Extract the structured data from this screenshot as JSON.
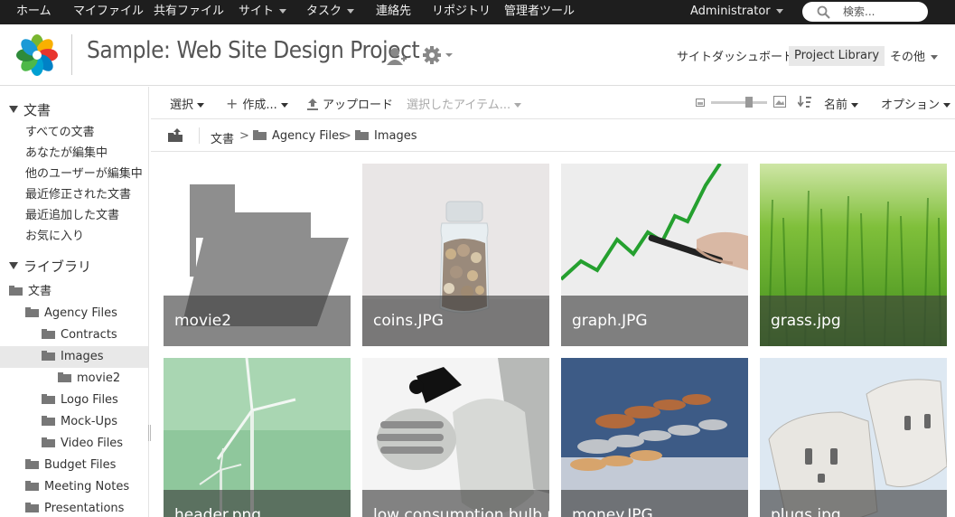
{
  "topnav": {
    "items": [
      {
        "label": "ホーム"
      },
      {
        "label": "マイファイル"
      },
      {
        "label": "共有ファイル"
      },
      {
        "label": "サイト"
      },
      {
        "label": "タスク"
      },
      {
        "label": "連絡先"
      },
      {
        "label": "リポジトリ"
      },
      {
        "label": "管理者ツール"
      }
    ],
    "user": "Administrator",
    "search_placeholder": "検索..."
  },
  "header": {
    "site_title": "Sample: Web Site Design Project",
    "links": {
      "dashboard": "サイトダッシュボード",
      "library": "Project Library",
      "more": "その他"
    }
  },
  "sidebar": {
    "docs_heading": "文書",
    "doc_filters": [
      "すべての文書",
      "あなたが編集中",
      "他のユーザーが編集中",
      "最近修正された文書",
      "最近追加した文書",
      "お気に入り"
    ],
    "library_heading": "ライブラリ",
    "tree": [
      {
        "label": "文書"
      },
      {
        "label": "Agency Files"
      },
      {
        "label": "Contracts"
      },
      {
        "label": "Images"
      },
      {
        "label": "movie2"
      },
      {
        "label": "Logo Files"
      },
      {
        "label": "Mock-Ups"
      },
      {
        "label": "Video Files"
      },
      {
        "label": "Budget Files"
      },
      {
        "label": "Meeting Notes"
      },
      {
        "label": "Presentations"
      }
    ]
  },
  "toolbar": {
    "select": "選択",
    "create": "作成...",
    "upload": "アップロード",
    "selected_items": "選択したアイテム...",
    "sort": "名前",
    "options": "オプション"
  },
  "breadcrumb": [
    "文書",
    "Agency Files",
    "Images"
  ],
  "breadcrumb_separator": ">",
  "items": [
    {
      "name": "movie2",
      "type": "folder"
    },
    {
      "name": "coins.JPG",
      "type": "image"
    },
    {
      "name": "graph.JPG",
      "type": "image"
    },
    {
      "name": "grass.jpg",
      "type": "image"
    },
    {
      "name": "header.png",
      "type": "image"
    },
    {
      "name": "low consumption bulb.png",
      "type": "image"
    },
    {
      "name": "money.JPG",
      "type": "image"
    },
    {
      "name": "plugs.jpg",
      "type": "image"
    }
  ],
  "colors": {
    "topnav_bg": "#1e1e1e",
    "label_overlay": "#3c3c3c",
    "selected_row": "#e8e8e8"
  }
}
